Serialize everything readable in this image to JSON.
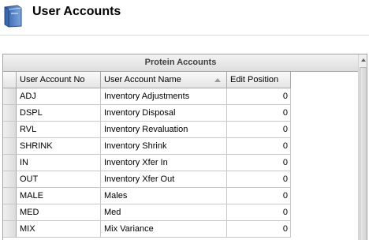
{
  "header": {
    "title": "User Accounts",
    "icon": "book-icon"
  },
  "grid": {
    "group_title": "Protein Accounts",
    "columns": [
      {
        "label": "User Account No",
        "sorted": false
      },
      {
        "label": "User Account Name",
        "sorted": true,
        "sort_direction": "ascending"
      },
      {
        "label": "Edit Position",
        "sorted": false
      }
    ],
    "rows": [
      {
        "account_no": "ADJ",
        "account_name": "Inventory Adjustments",
        "edit_position": "0"
      },
      {
        "account_no": "DSPL",
        "account_name": "Inventory Disposal",
        "edit_position": "0"
      },
      {
        "account_no": "RVL",
        "account_name": "Inventory Revaluation",
        "edit_position": "0"
      },
      {
        "account_no": "SHRINK",
        "account_name": "Inventory Shrink",
        "edit_position": "0"
      },
      {
        "account_no": "IN",
        "account_name": "Inventory Xfer In",
        "edit_position": "0"
      },
      {
        "account_no": "OUT",
        "account_name": "Inventory Xfer Out",
        "edit_position": "0"
      },
      {
        "account_no": "MALE",
        "account_name": "Males",
        "edit_position": "0"
      },
      {
        "account_no": "MED",
        "account_name": "Med",
        "edit_position": "0"
      },
      {
        "account_no": "MIX",
        "account_name": "Mix Variance",
        "edit_position": "0"
      }
    ]
  },
  "colors": {
    "grid_border": "#a3a3a3",
    "header_text": "#404040",
    "icon_blue": "#3f6fb6"
  }
}
